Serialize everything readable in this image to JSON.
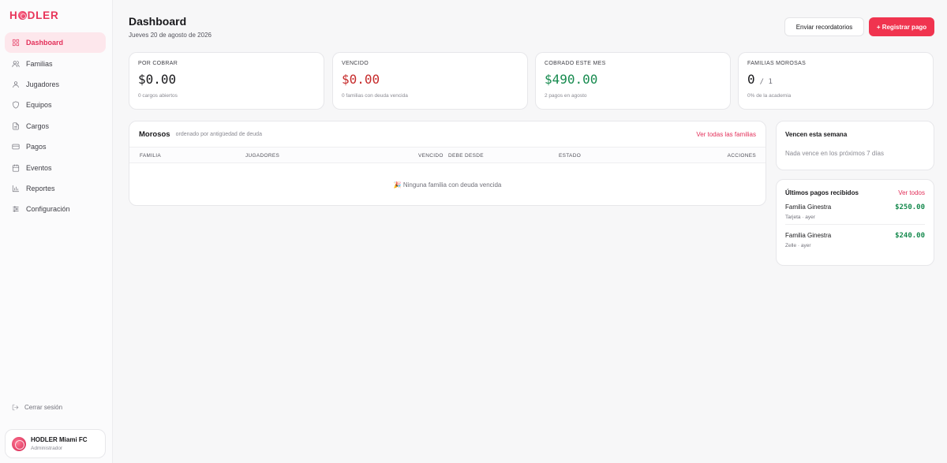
{
  "brand": {
    "name_parts": [
      "H",
      "DLER"
    ]
  },
  "sidebar": {
    "items": [
      {
        "label": "Dashboard",
        "icon": "grid-icon",
        "active": true
      },
      {
        "label": "Familias",
        "icon": "users-icon"
      },
      {
        "label": "Jugadores",
        "icon": "user-icon"
      },
      {
        "label": "Equipos",
        "icon": "shield-icon"
      },
      {
        "label": "Cargos",
        "icon": "document-icon"
      },
      {
        "label": "Pagos",
        "icon": "credit-card-icon"
      },
      {
        "label": "Eventos",
        "icon": "calendar-icon"
      },
      {
        "label": "Reportes",
        "icon": "bar-chart-icon"
      },
      {
        "label": "Configuración",
        "icon": "sliders-icon"
      }
    ],
    "logout_label": "Cerrar sesión",
    "profile": {
      "name": "HODLER Miami FC",
      "role": "Administrador"
    }
  },
  "header": {
    "title": "Dashboard",
    "date": "Jueves 20 de agosto de 2026",
    "reminders_label": "Enviar recordatorios",
    "register_label": "+ Registrar pago"
  },
  "stats": [
    {
      "label": "POR COBRAR",
      "value": "$0.00",
      "sub": "0 cargos abiertos",
      "color": "#18181b"
    },
    {
      "label": "VENCIDO",
      "value": "$0.00",
      "sub": "0 familias con deuda vencida",
      "color": "#c62a2a"
    },
    {
      "label": "COBRADO ESTE MES",
      "value": "$490.00",
      "sub": "2 pagos en agosto",
      "color": "#168a4e"
    },
    {
      "label": "FAMILIAS MOROSAS",
      "value": "0",
      "of": "/ 1",
      "sub": "0% de la academia",
      "color": "#18181b"
    }
  ],
  "morosos": {
    "title": "Morosos",
    "subtitle": "ordenado por antigüedad de deuda",
    "link": "Ver todas las familias",
    "columns": [
      "FAMILIA",
      "JUGADORES",
      "VENCIDO",
      "DEBE DESDE",
      "ESTADO",
      "ACCIONES"
    ],
    "empty_message": "🎉 Ninguna familia con deuda vencida"
  },
  "week": {
    "title": "Vencen esta semana",
    "message": "Nada vence en los próximos 7 días"
  },
  "payments": {
    "title": "Últimos pagos recibidos",
    "link": "Ver todos",
    "items": [
      {
        "family": "Familia Ginestra",
        "meta": "Tarjeta · ayer",
        "amount": "$250.00"
      },
      {
        "family": "Familia Ginestra",
        "meta": "Zelle · ayer",
        "amount": "$240.00"
      }
    ]
  },
  "colors": {
    "accent": "#e3305a",
    "primary_button": "#f0344f",
    "positive": "#168a4e",
    "negative": "#c62a2a"
  }
}
